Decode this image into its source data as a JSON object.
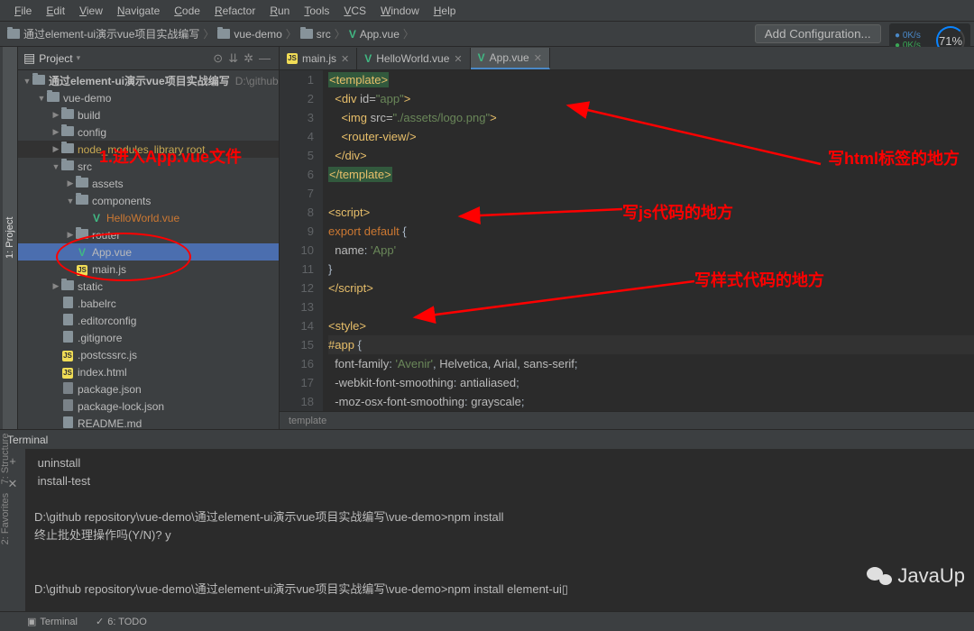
{
  "menu": [
    "File",
    "Edit",
    "View",
    "Navigate",
    "Code",
    "Refactor",
    "Run",
    "Tools",
    "VCS",
    "Window",
    "Help"
  ],
  "breadcrumb": {
    "root": "通过element-ui演示vue项目实战编写",
    "parts": [
      "vue-demo",
      "src",
      "App.vue"
    ]
  },
  "add_config": "Add Configuration...",
  "cpu": {
    "up": "0K/s",
    "down": "0K/s",
    "pct": "71%"
  },
  "project": {
    "title": "Project",
    "root": "通过element-ui演示vue项目实战编写",
    "root_path": "D:\\github",
    "tree": [
      {
        "d": 1,
        "icon": "folder",
        "label": "vue-demo",
        "arrow": "down"
      },
      {
        "d": 2,
        "icon": "folder",
        "label": "build",
        "arrow": "right"
      },
      {
        "d": 2,
        "icon": "folder",
        "label": "config",
        "arrow": "right"
      },
      {
        "d": 2,
        "icon": "folder",
        "label": "node_modules",
        "suffix": "library root",
        "arrow": "right",
        "hl": true
      },
      {
        "d": 2,
        "icon": "folder",
        "label": "src",
        "arrow": "down"
      },
      {
        "d": 3,
        "icon": "folder",
        "label": "assets",
        "arrow": "right"
      },
      {
        "d": 3,
        "icon": "folder",
        "label": "components",
        "arrow": "down"
      },
      {
        "d": 4,
        "icon": "vue",
        "label": "HelloWorld.vue",
        "warn": true
      },
      {
        "d": 3,
        "icon": "folder",
        "label": "router",
        "arrow": "right"
      },
      {
        "d": 3,
        "icon": "vue",
        "label": "App.vue",
        "selected": true
      },
      {
        "d": 3,
        "icon": "js",
        "label": "main.js"
      },
      {
        "d": 2,
        "icon": "folder",
        "label": "static",
        "arrow": "right"
      },
      {
        "d": 2,
        "icon": "file",
        "label": ".babelrc"
      },
      {
        "d": 2,
        "icon": "file",
        "label": ".editorconfig"
      },
      {
        "d": 2,
        "icon": "file",
        "label": ".gitignore"
      },
      {
        "d": 2,
        "icon": "jsf",
        "label": ".postcssrc.js"
      },
      {
        "d": 2,
        "icon": "jsf",
        "label": "index.html"
      },
      {
        "d": 2,
        "icon": "json",
        "label": "package.json"
      },
      {
        "d": 2,
        "icon": "json",
        "label": "package-lock.json"
      },
      {
        "d": 2,
        "icon": "file",
        "label": "README.md"
      }
    ]
  },
  "editor": {
    "tabs": [
      {
        "icon": "js",
        "label": "main.js"
      },
      {
        "icon": "vue",
        "label": "HelloWorld.vue"
      },
      {
        "icon": "vue",
        "label": "App.vue",
        "active": true
      }
    ],
    "lines": [
      {
        "n": 1,
        "html": "<span class='hl-match'><span class='c-tag'>&lt;template&gt;</span></span>"
      },
      {
        "n": 2,
        "html": "  <span class='c-tag'>&lt;div</span> <span class='c-attr'>id=</span><span class='c-str'>\"app\"</span><span class='c-tag'>&gt;</span>"
      },
      {
        "n": 3,
        "html": "    <span class='c-tag'>&lt;img</span> <span class='c-attr'>src=</span><span class='c-str'>\"./assets/logo.png\"</span><span class='c-tag'>&gt;</span>"
      },
      {
        "n": 4,
        "html": "    <span class='c-tag'>&lt;router-view/&gt;</span>"
      },
      {
        "n": 5,
        "html": "  <span class='c-tag'>&lt;/div&gt;</span>"
      },
      {
        "n": 6,
        "html": "<span class='hl-match'><span class='c-tag'>&lt;/template&gt;</span></span>"
      },
      {
        "n": 7,
        "html": ""
      },
      {
        "n": 8,
        "html": "<span class='c-tag'>&lt;script&gt;</span>"
      },
      {
        "n": 9,
        "html": "<span class='c-kw'>export default</span> <span class='c-punc'>{</span>"
      },
      {
        "n": 10,
        "html": "  <span class='c-prop'>name</span><span class='c-punc'>:</span> <span class='c-str'>'App'</span>"
      },
      {
        "n": 11,
        "html": "<span class='c-punc'>}</span>"
      },
      {
        "n": 12,
        "html": "<span class='c-tag'>&lt;/script&gt;</span>"
      },
      {
        "n": 13,
        "html": ""
      },
      {
        "n": 14,
        "html": "<span class='c-tag'>&lt;style&gt;</span>"
      },
      {
        "n": 15,
        "html": "<span class='c-sel'>#app</span> <span class='c-punc'>{</span>",
        "caret": true
      },
      {
        "n": 16,
        "html": "  <span class='c-prop'>font-family</span><span class='c-punc'>:</span> <span class='c-str'>'Avenir'</span><span class='c-punc'>,</span> <span class='c-prop'>Helvetica</span><span class='c-punc'>,</span> <span class='c-prop'>Arial</span><span class='c-punc'>,</span> <span class='c-prop'>sans-serif</span><span class='c-punc'>;</span>"
      },
      {
        "n": 17,
        "html": "  <span class='c-prop'>-webkit-font-smoothing</span><span class='c-punc'>:</span> <span class='c-prop'>antialiased</span><span class='c-punc'>;</span>"
      },
      {
        "n": 18,
        "html": "  <span class='c-prop'>-moz-osx-font-smoothing</span><span class='c-punc'>:</span> <span class='c-prop'>grayscale</span><span class='c-punc'>;</span>"
      }
    ],
    "crumb": "template"
  },
  "terminal": {
    "title": "Terminal",
    "lines": [
      " uninstall",
      " install-test",
      "",
      "D:\\github repository\\vue-demo\\通过element-ui演示vue项目实战编写\\vue-demo>npm install",
      "终止批处理操作吗(Y/N)? y",
      "",
      "",
      "D:\\github repository\\vue-demo\\通过element-ui演示vue项目实战编写\\vue-demo>npm install element-ui▯"
    ]
  },
  "bottom_tabs": [
    "Terminal",
    "6: TODO"
  ],
  "annotations": {
    "a1": "1.进入App.vue文件",
    "a2": "写html标签的地方",
    "a3": "写js代码的地方",
    "a4": "写样式代码的地方"
  },
  "side_tabs": [
    "1: Project",
    "2: Favorites",
    "7: Structure"
  ],
  "watermark": "JavaUp"
}
